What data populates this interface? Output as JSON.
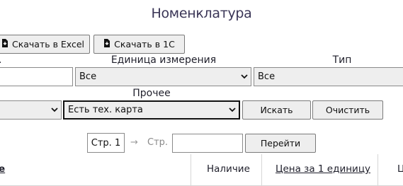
{
  "page": {
    "title": "Номенклатура"
  },
  "toolbar": {
    "excel_label": "Скачать в Excel",
    "onec_label": "Скачать в 1С"
  },
  "filters": {
    "unit_label": "Единица измерения",
    "type_label": "Тип",
    "unit_value": "Все",
    "type_value": "Все",
    "other_label": "Прочее",
    "other_value": "Есть тех. карта",
    "search_label": "Искать",
    "clear_label": "Очистить"
  },
  "pager": {
    "current_page": "Стр. 1",
    "arrow": "→",
    "page_prefix": "Стр.",
    "page_input_value": "",
    "go_label": "Перейти"
  },
  "table": {
    "col_name_partial": "е",
    "col_availability": "Наличие",
    "col_price": "Цена за 1 единицу",
    "col_next_partial": "Ц"
  },
  "icons": {
    "download": "download-file-icon",
    "chevron": "chevron-down-icon"
  }
}
